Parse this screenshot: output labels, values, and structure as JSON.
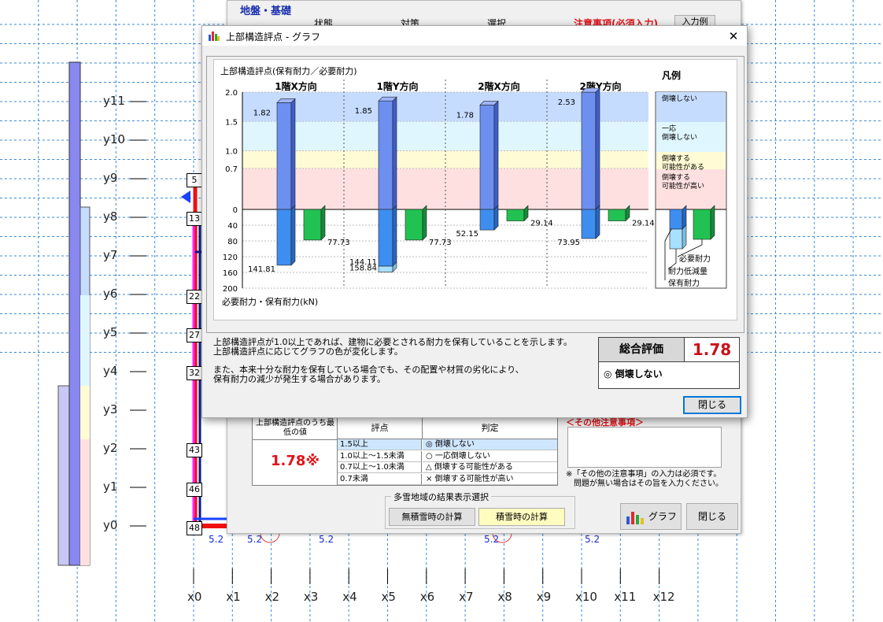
{
  "background": {
    "y_labels": [
      "y11",
      "y10",
      "y9",
      "y8",
      "y7",
      "y6",
      "y5",
      "y4",
      "y3",
      "y2",
      "y1",
      "y0"
    ],
    "x_labels": [
      "x0",
      "x1",
      "x2",
      "x3",
      "x4",
      "x5",
      "x6",
      "x7",
      "x8",
      "x9",
      "x10",
      "x11",
      "x12"
    ],
    "node_numbers": [
      "5",
      "13",
      "22",
      "27",
      "32",
      "43",
      "46",
      "48"
    ],
    "span_labels": [
      "5.2",
      "5.2",
      "5.2",
      "5.2",
      "5.2"
    ]
  },
  "back_dialog": {
    "section_title": "地盤・基礎",
    "header_cols": [
      "状態",
      "対策",
      "選択"
    ],
    "notice_header": "注意事項(必須入力)",
    "example_button": "入力例",
    "lowest_score_label": "上部構造評点のうち最低の値",
    "lowest_score_value": "1.78※",
    "table_headers": [
      "評点",
      "判定"
    ],
    "rating_rows": [
      {
        "range": "1.5以上",
        "symbol": "◎",
        "judgement": "倒壊しない"
      },
      {
        "range": "1.0以上～1.5未満",
        "symbol": "○",
        "judgement": "一応倒壊しない"
      },
      {
        "range": "0.7以上～1.0未満",
        "symbol": "△",
        "judgement": "倒壊する可能性がある"
      },
      {
        "range": "0.7未満",
        "symbol": "×",
        "judgement": "倒壊する可能性が高い"
      }
    ],
    "other_notes_header": "＜その他注意事項＞",
    "other_notes_help": [
      "※「その他の注意事項」の入力は必須です。",
      "問題が無い場合はその旨を入力ください。"
    ],
    "snow_group_label": "多雪地域の結果表示選択",
    "snow_buttons": [
      "無積雪時の計算",
      "積雪時の計算"
    ],
    "graph_button": "グラフ",
    "close_button": "閉じる"
  },
  "dialog": {
    "title": "上部構造評点 - グラフ",
    "close_symbol": "✕",
    "description_1": [
      "上部構造評点が1.0以上であれば、建物に必要とされる耐力を保有していることを示します。",
      "上部構造評点に応じてグラフの色が変化します。"
    ],
    "description_2": [
      "また、本来十分な耐力を保有している場合でも、その配置や材質の劣化により、",
      "保有耐力の減少が発生する場合があります。"
    ],
    "overall_label": "総合評価",
    "overall_value": "1.78",
    "overall_symbol": "◎",
    "overall_judgement": "倒壊しない",
    "close_button": "閉じる"
  },
  "colors": {
    "band_safe": "#c5dcff",
    "band_mostly_safe": "#dff6ff",
    "band_possible": "#fffbd5",
    "band_high": "#ffe0e0",
    "score_bar": "#6d8ff0",
    "capacity_bar": "#3d8ef0",
    "capacity_reduction": "#a8e0ff",
    "required_bar": "#22c252",
    "accent_red": "#e0141a"
  },
  "chart_data": {
    "type": "bar",
    "title": "上部構造評点(保有耐力／必要耐力)",
    "bottom_axis_label": "必要耐力・保有耐力(kN)",
    "groups": [
      "1階X方向",
      "1階Y方向",
      "2階X方向",
      "2階Y方向"
    ],
    "score_ticks": [
      "2.0",
      "1.5",
      "1.0",
      "0.7",
      "0"
    ],
    "force_ticks": [
      "40",
      "80",
      "120",
      "160",
      "200"
    ],
    "score_range": [
      0,
      2.0
    ],
    "force_range": [
      0,
      200
    ],
    "series": [
      {
        "name": "上部構造評点",
        "values": [
          1.82,
          1.85,
          1.78,
          2.53
        ],
        "labels": [
          "1.82",
          "1.85",
          "1.78",
          "2.53"
        ]
      },
      {
        "name": "保有耐力",
        "values": [
          141.81,
          144.11,
          52.15,
          73.95
        ],
        "labels": [
          "141.81",
          "144.11",
          "52.15",
          "73.95"
        ]
      },
      {
        "name": "耐力低減量",
        "values": [
          0,
          14.73,
          0,
          0
        ],
        "labels": [
          "",
          "158.84",
          "",
          ""
        ]
      },
      {
        "name": "必要耐力",
        "values": [
          77.73,
          77.73,
          29.14,
          29.14
        ],
        "labels": [
          "77.73",
          "77.73",
          "29.14",
          "29.14"
        ]
      }
    ],
    "legend_title": "凡例",
    "legend_bands": [
      "倒壊しない",
      "一応倒壊しない",
      "倒壊する可能性がある",
      "倒壊する可能性が高い"
    ],
    "legend_bars": [
      "必要耐力",
      "耐力低減量",
      "保有耐力"
    ]
  }
}
